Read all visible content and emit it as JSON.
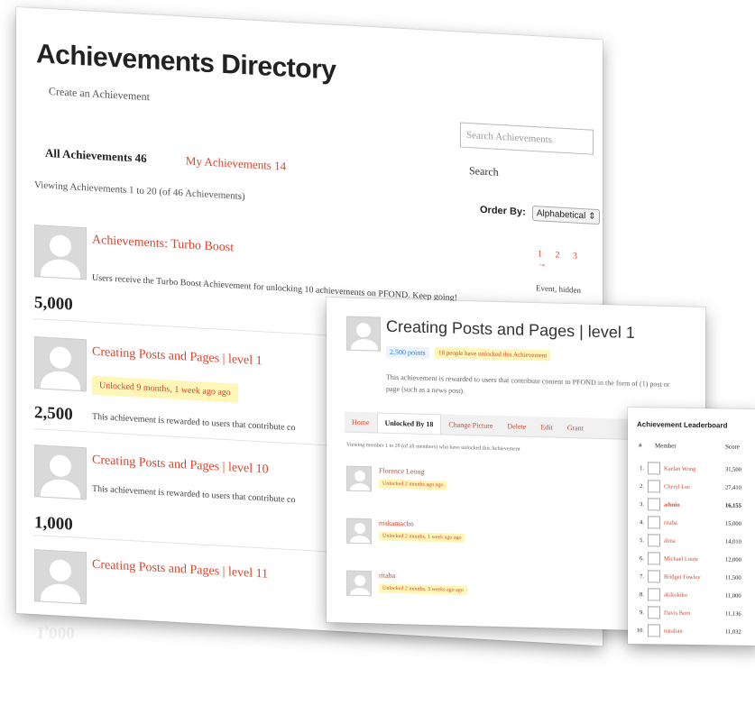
{
  "main": {
    "title": "Achievements Directory",
    "create_link": "Create an Achievement",
    "search_placeholder": "Search Achievements",
    "search_button": "Search",
    "tab_all": "All Achievements 46",
    "tab_my": "My Achievements 14",
    "viewing": "Viewing Achievements 1 to 20 (of 46 Achievements)",
    "order_by_label": "Order By:",
    "order_by_value": "Alphabetical",
    "pager": "1 2 3 →",
    "achievements": [
      {
        "title": "Achievements: Turbo Boost",
        "desc": "Users receive the Turbo Boost Achievement for unlocking 10 achievements on PFOND. Keep going!",
        "tag": "Event, hidden",
        "points": "5,000"
      },
      {
        "title": "Creating Posts and Pages | level 1",
        "unlocked": "Unlocked 9 months, 1 week ago ago",
        "desc": "This achievement is rewarded to users that contribute co",
        "points": "2,500"
      },
      {
        "title": "Creating Posts and Pages | level 10",
        "desc": "This achievement is rewarded to users that contribute co",
        "points": "1,000"
      },
      {
        "title": "Creating Posts and Pages | level 11"
      }
    ]
  },
  "detail": {
    "title": "Creating Posts and Pages | level 1",
    "points": "2,500 points",
    "count": "18 people have unlocked this Achievement",
    "desc": "This achievement is rewarded to users that contribute content to PFOND in the form of (1) post or page (such as a news post).",
    "tabs": [
      "Home",
      "Unlocked By 18",
      "Change Picture",
      "Delete",
      "Edit",
      "Grant"
    ],
    "viewing": "Viewing member 1 to 20 (of all members) who have unlocked this Achievement",
    "members": [
      {
        "name": "Florence Leong",
        "unlocked": "Unlocked 2 months ago ago"
      },
      {
        "name": "makamacho",
        "unlocked": "Unlocked 2 months, 1 week ago ago"
      },
      {
        "name": "ritaba",
        "unlocked": "Unlocked 2 months, 3 weeks ago ago"
      }
    ]
  },
  "board": {
    "title": "Achievement Leaderboard",
    "col_rank": "#",
    "col_member": "Member",
    "col_score": "Score",
    "rows": [
      {
        "rank": "1.",
        "name": "Kaelan Wong",
        "score": "31,500"
      },
      {
        "rank": "2.",
        "name": "Cheryl Lee",
        "score": "27,410"
      },
      {
        "rank": "3.",
        "name": "admin",
        "score": "16,155"
      },
      {
        "rank": "4.",
        "name": "ritaba",
        "score": "15,000"
      },
      {
        "rank": "5.",
        "name": "alma",
        "score": "14,010"
      },
      {
        "rank": "6.",
        "name": "Michael Louie",
        "score": "12,000"
      },
      {
        "rank": "7.",
        "name": "Bridget Fowley",
        "score": "11,500"
      },
      {
        "rank": "8.",
        "name": "akikokiko",
        "score": "11,000"
      },
      {
        "rank": "9.",
        "name": "Davis Bern",
        "score": "11,136"
      },
      {
        "rank": "10.",
        "name": "natalian",
        "score": "11,032"
      }
    ]
  },
  "reflection": {
    "points": "1,000",
    "title": "Creating Posts and Pages | level 11"
  }
}
